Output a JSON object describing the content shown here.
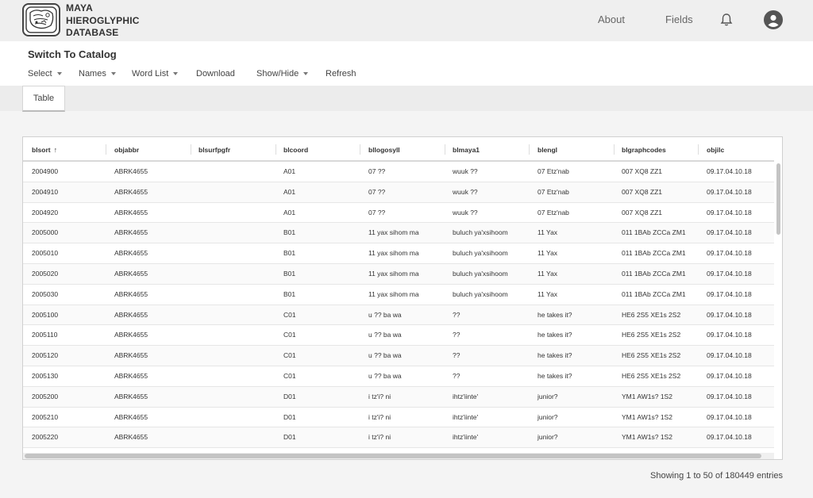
{
  "brand": {
    "line1": "MAYA",
    "line2": "HIEROGLYPHIC",
    "line3": "DATABASE",
    "logo_icon": "glyph-logo-icon"
  },
  "nav": {
    "about": "About",
    "fields": "Fields",
    "bell_icon": "bell-icon",
    "account_icon": "account-icon"
  },
  "toolbar": {
    "title": "Switch To Catalog",
    "items": [
      "Select",
      "Names",
      "Word List",
      "Download",
      "Show/Hide",
      "Refresh"
    ]
  },
  "tabs": {
    "table": "Table"
  },
  "table": {
    "columns": [
      "blsort",
      "objabbr",
      "blsurfpgfr",
      "blcoord",
      "bllogosyll",
      "blmaya1",
      "blengl",
      "blgraphcodes",
      "objilc"
    ],
    "sort_indicator": "↑",
    "rows": [
      [
        "2004900",
        "ABRK4655",
        "",
        "A01",
        "07 ??",
        "wuuk ??",
        "07 Etz'nab",
        "007 XQ8 ZZ1",
        "09.17.04.10.18"
      ],
      [
        "2004910",
        "ABRK4655",
        "",
        "A01",
        "07 ??",
        "wuuk ??",
        "07 Etz'nab",
        "007 XQ8 ZZ1",
        "09.17.04.10.18"
      ],
      [
        "2004920",
        "ABRK4655",
        "",
        "A01",
        "07 ??",
        "wuuk ??",
        "07 Etz'nab",
        "007 XQ8 ZZ1",
        "09.17.04.10.18"
      ],
      [
        "2005000",
        "ABRK4655",
        "",
        "B01",
        "11 yax sihom ma",
        "buluch ya'xsihoom",
        "11 Yax",
        "011 1BAb ZCCa ZM1",
        "09.17.04.10.18"
      ],
      [
        "2005010",
        "ABRK4655",
        "",
        "B01",
        "11 yax sihom ma",
        "buluch ya'xsihoom",
        "11 Yax",
        "011 1BAb ZCCa ZM1",
        "09.17.04.10.18"
      ],
      [
        "2005020",
        "ABRK4655",
        "",
        "B01",
        "11 yax sihom ma",
        "buluch ya'xsihoom",
        "11 Yax",
        "011 1BAb ZCCa ZM1",
        "09.17.04.10.18"
      ],
      [
        "2005030",
        "ABRK4655",
        "",
        "B01",
        "11 yax sihom ma",
        "buluch ya'xsihoom",
        "11 Yax",
        "011 1BAb ZCCa ZM1",
        "09.17.04.10.18"
      ],
      [
        "2005100",
        "ABRK4655",
        "",
        "C01",
        "u ?? ba wa",
        "??",
        "he takes it?",
        "HE6 2S5 XE1s 2S2",
        "09.17.04.10.18"
      ],
      [
        "2005110",
        "ABRK4655",
        "",
        "C01",
        "u ?? ba wa",
        "??",
        "he takes it?",
        "HE6 2S5 XE1s 2S2",
        "09.17.04.10.18"
      ],
      [
        "2005120",
        "ABRK4655",
        "",
        "C01",
        "u ?? ba wa",
        "??",
        "he takes it?",
        "HE6 2S5 XE1s 2S2",
        "09.17.04.10.18"
      ],
      [
        "2005130",
        "ABRK4655",
        "",
        "C01",
        "u ?? ba wa",
        "??",
        "he takes it?",
        "HE6 2S5 XE1s 2S2",
        "09.17.04.10.18"
      ],
      [
        "2005200",
        "ABRK4655",
        "",
        "D01",
        "i tz'i? ni",
        "ihtz'iinte'",
        "junior?",
        "YM1 AW1s? 1S2",
        "09.17.04.10.18"
      ],
      [
        "2005210",
        "ABRK4655",
        "",
        "D01",
        "i tz'i? ni",
        "ihtz'iinte'",
        "junior?",
        "YM1 AW1s? 1S2",
        "09.17.04.10.18"
      ],
      [
        "2005220",
        "ABRK4655",
        "",
        "D01",
        "i tz'i? ni",
        "ihtz'iinte'",
        "junior?",
        "YM1 AW1s? 1S2",
        "09.17.04.10.18"
      ]
    ]
  },
  "footer": {
    "info": "Showing 1 to 50 of 180449 entries"
  },
  "colors": {
    "header_bg": "#efefef",
    "toolbar_bg": "#ffffff",
    "accent": "#555555"
  }
}
